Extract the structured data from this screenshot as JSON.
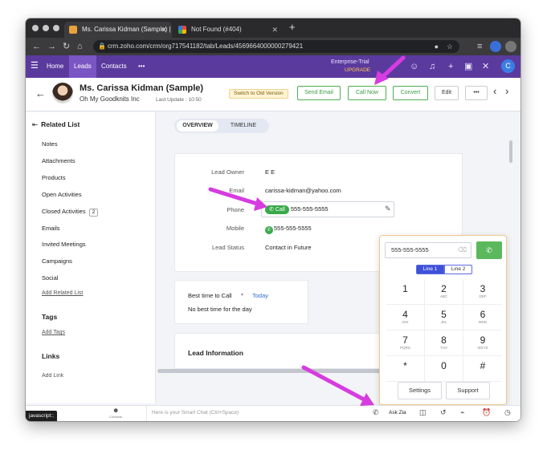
{
  "browser": {
    "tabs": [
      {
        "title": "Ms. Carissa Kidman (Sample) |",
        "active": true
      },
      {
        "title": "Not Found (#404)",
        "active": false
      }
    ],
    "new_tab_symbol": "+",
    "url": "crm.zoho.com/crm/org717541182/tab/Leads/4569664000000279421"
  },
  "appbar": {
    "nav": [
      "Home",
      "Leads",
      "Contacts",
      "•••"
    ],
    "active_nav": "Leads",
    "trial_label": "Enterprise-Trial",
    "upgrade_label": "UPGRADE",
    "avatar_letter": "C"
  },
  "record": {
    "name": "Ms. Carissa Kidman (Sample)",
    "company": "Oh My Goodknits Inc",
    "last_update_label": "Last Update : 10:50",
    "switch_label": "Switch to Old Version",
    "buttons": [
      "Send Email",
      "Call Now",
      "Convert",
      "Edit",
      "•••"
    ]
  },
  "sidebar": {
    "related_title": "Related List",
    "related_items": [
      "Notes",
      "Attachments",
      "Products",
      "Open Activities",
      "Closed Activities",
      "Emails",
      "Invited Meetings",
      "Campaigns",
      "Social"
    ],
    "closed_activities_count": "2",
    "add_related_label": "Add Related List",
    "tags_title": "Tags",
    "add_tags_label": "Add Tags",
    "links_title": "Links",
    "add_link_label": "Add Link"
  },
  "view_tabs": [
    "OVERVIEW",
    "TIMELINE"
  ],
  "overview": {
    "fields": [
      {
        "label": "Lead Owner",
        "value": "E E"
      },
      {
        "label": "Email",
        "value": "carissa-kidman@yahoo.com"
      },
      {
        "label": "Phone",
        "value": "555-555-5555",
        "call_label": "Call"
      },
      {
        "label": "Mobile",
        "value": "555-555-5555"
      },
      {
        "label": "Lead Status",
        "value": "Contact in Future"
      }
    ]
  },
  "best_time": {
    "label": "Best time to Call",
    "filter": "Today",
    "empty_text": "No best time for the day"
  },
  "lead_info_title": "Lead Information",
  "dialpad": {
    "number": "555-555-5555",
    "lines": [
      "Line 1",
      "Line 2"
    ],
    "keys": [
      {
        "d": "1",
        "s": ""
      },
      {
        "d": "2",
        "s": "ABC"
      },
      {
        "d": "3",
        "s": "DEF"
      },
      {
        "d": "4",
        "s": "GHI"
      },
      {
        "d": "5",
        "s": "JKL"
      },
      {
        "d": "6",
        "s": "MNO"
      },
      {
        "d": "7",
        "s": "PQRS"
      },
      {
        "d": "8",
        "s": "TUV"
      },
      {
        "d": "9",
        "s": "WXYZ"
      },
      {
        "d": "*",
        "s": ""
      },
      {
        "d": "0",
        "s": ""
      },
      {
        "d": "#",
        "s": ""
      }
    ],
    "settings_label": "Settings",
    "support_label": "Support"
  },
  "bottombar": {
    "contacts_label": "Contacts",
    "chat_placeholder": "Here is your Smart Chat (Ctrl+Space)",
    "ask_zia": "Ask Zia",
    "status_tip": "javascript:;"
  },
  "colors": {
    "brand_purple": "#5b3a9e",
    "call_green": "#39a94b",
    "annotation_magenta": "#d63ce0"
  }
}
